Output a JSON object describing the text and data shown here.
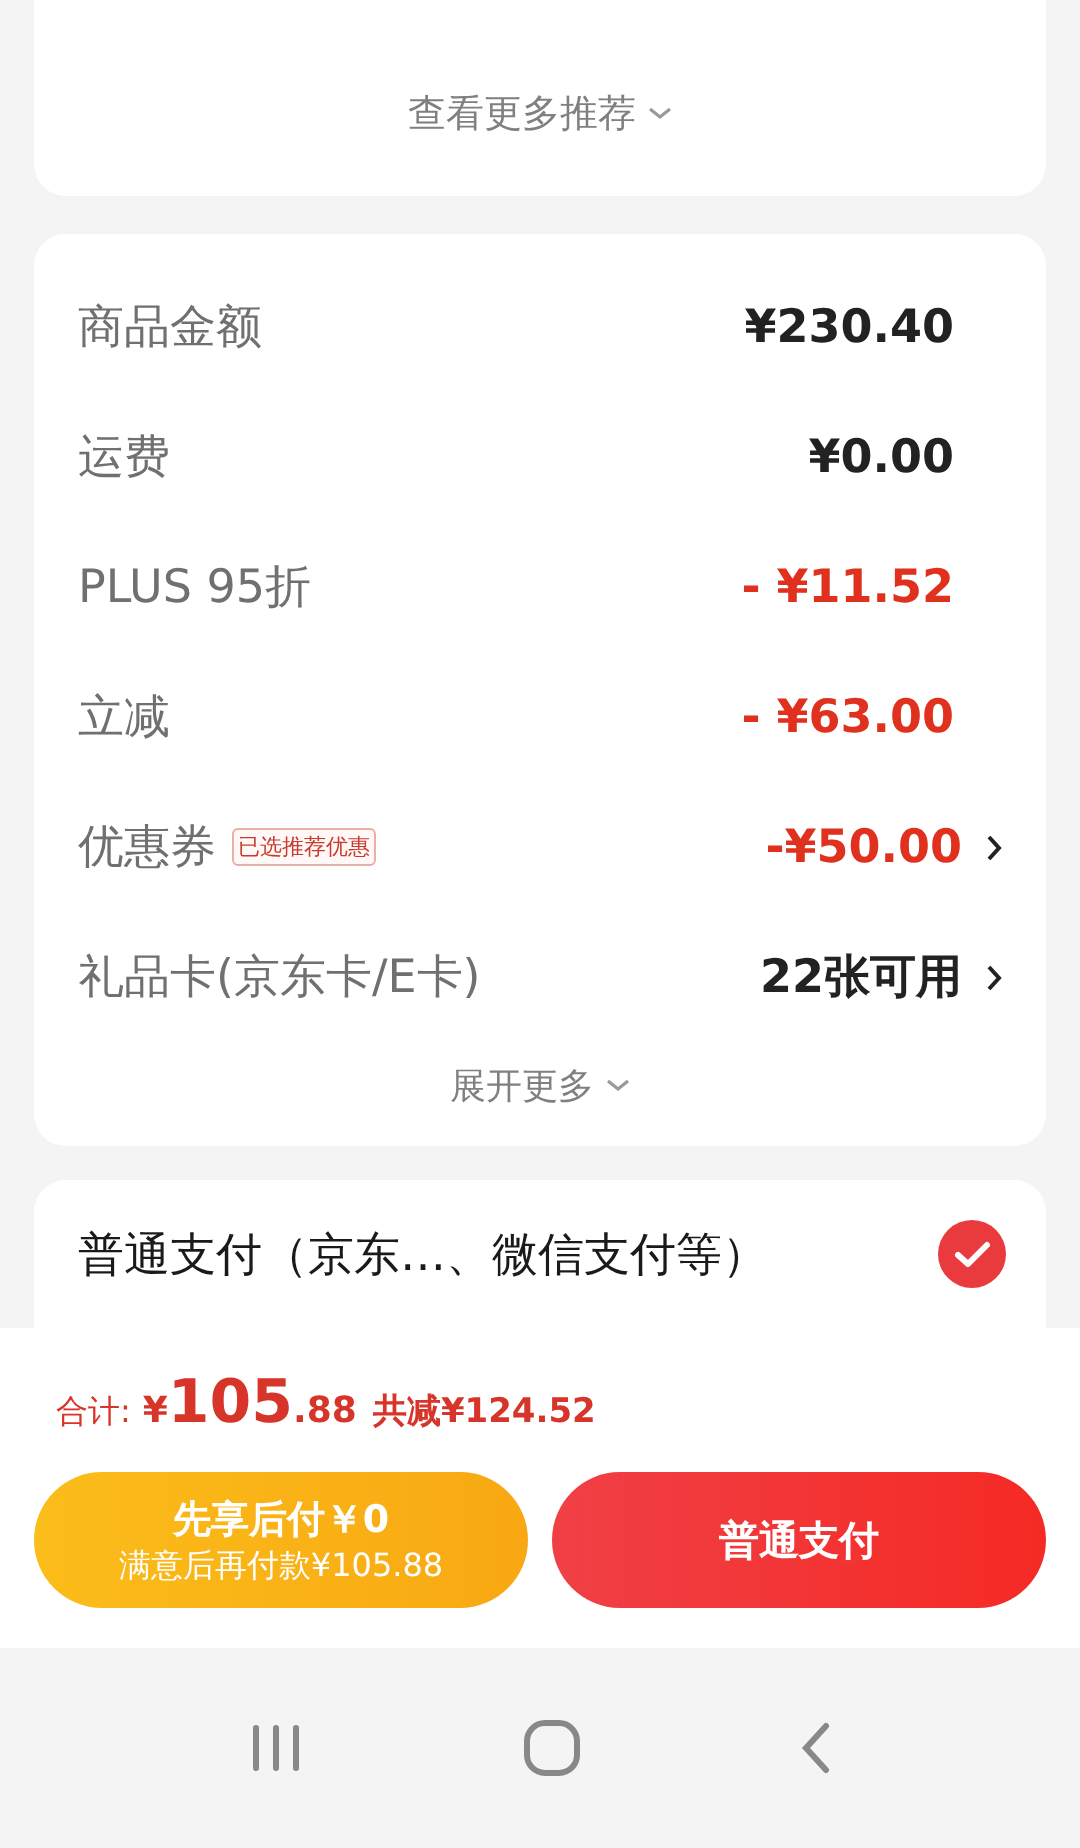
{
  "recommend": {
    "more_link": "查看更多推荐"
  },
  "summary": {
    "rows": [
      {
        "label": "商品金额",
        "value": "¥230.40",
        "kind": "amount",
        "chevron": false
      },
      {
        "label": "运费",
        "value": "¥0.00",
        "kind": "amount",
        "chevron": false
      },
      {
        "label": "PLUS 95折",
        "value": "- ¥11.52",
        "kind": "discount",
        "chevron": false
      },
      {
        "label": "立减",
        "value": "- ¥63.00",
        "kind": "discount",
        "chevron": false
      },
      {
        "label": "优惠券",
        "badge": "已选推荐优惠",
        "value": "-¥50.00",
        "kind": "discount",
        "chevron": true
      },
      {
        "label": "礼品卡(京东卡/E卡)",
        "value": "22张可用",
        "kind": "amount",
        "chevron": true
      }
    ],
    "expand_link": "展开更多"
  },
  "payment": {
    "option": {
      "label": "普通支付（京东…、微信支付等）",
      "checked": true
    }
  },
  "footer": {
    "total_label": "合计:",
    "currency": "¥",
    "amount_integer": "105",
    "amount_decimal": ".88",
    "savings": "共减¥124.52",
    "buttons": [
      {
        "kind": "later",
        "title": "先享后付￥0",
        "subtitle": "满意后再付款¥105.88"
      },
      {
        "kind": "pay",
        "title": "普通支付"
      }
    ]
  }
}
